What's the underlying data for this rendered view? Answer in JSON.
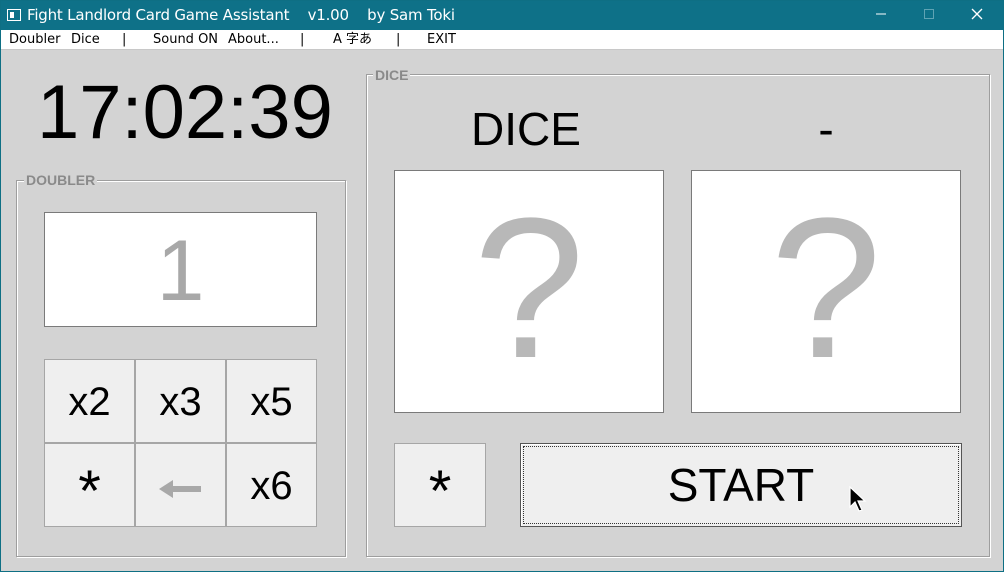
{
  "window": {
    "title": "Fight Landlord Card Game Assistant    v1.00    by Sam Toki",
    "minimize_glyph": "—",
    "close_glyph": "✕"
  },
  "menu": {
    "items": [
      "Doubler",
      "Dice",
      "|",
      "Sound ON",
      "About...",
      "|",
      "A 字あ",
      "|",
      "EXIT"
    ]
  },
  "clock": {
    "time": "17:02:39"
  },
  "doubler": {
    "label": "DOUBLER",
    "value": "1",
    "keys": [
      "x2",
      "x3",
      "x5",
      "*",
      "←",
      "x6"
    ]
  },
  "dice": {
    "label": "DICE",
    "title": "DICE",
    "result": "-",
    "die1_face": "?",
    "die2_face": "?",
    "star_label": "*",
    "start_label": "START"
  },
  "colors": {
    "titlebar": "#0e7188",
    "background": "#d3d3d3",
    "placeholder_gray": "#b8b8b8"
  }
}
